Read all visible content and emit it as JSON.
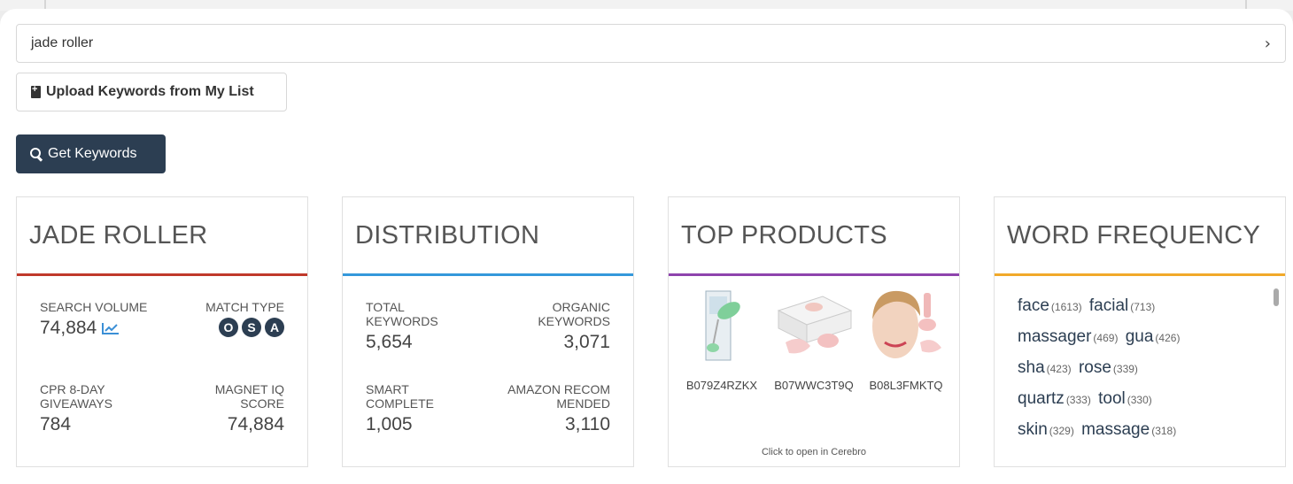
{
  "search": {
    "value": "jade roller",
    "arrow": "›"
  },
  "upload_label": "Upload Keywords from My List",
  "get_keywords_label": "Get Keywords",
  "cards": {
    "keyword": {
      "title": "JADE ROLLER",
      "search_volume_label": "SEARCH VOLUME",
      "search_volume": "74,884",
      "match_type_label": "MATCH TYPE",
      "match_badges": [
        "O",
        "S",
        "A"
      ],
      "cpr_label": "CPR 8-DAY GIVEAWAYS",
      "cpr": "784",
      "iq_label": "MAGNET IQ SCORE",
      "iq": "74,884"
    },
    "distribution": {
      "title": "DISTRIBUTION",
      "total_label": "TOTAL KEYWORDS",
      "total": "5,654",
      "organic_label": "ORGANIC KEYWORDS",
      "organic": "3,071",
      "smart_label": "SMART COMPLETE",
      "smart": "1,005",
      "amazon_label": "AMAZON RECOMMENDED",
      "amazon": "3,110"
    },
    "products": {
      "title": "TOP PRODUCTS",
      "items": [
        {
          "asin": "B079Z4RZKX"
        },
        {
          "asin": "B07WWC3T9Q"
        },
        {
          "asin": "B08L3FMKTQ"
        }
      ],
      "footer": "Click to open in Cerebro"
    },
    "words": {
      "title": "WORD FREQUENCY",
      "items": [
        {
          "word": "face",
          "count": "(1613)"
        },
        {
          "word": "facial",
          "count": "(713)"
        },
        {
          "word": "massager",
          "count": "(469)"
        },
        {
          "word": "gua",
          "count": "(426)"
        },
        {
          "word": "sha",
          "count": "(423)"
        },
        {
          "word": "rose",
          "count": "(339)"
        },
        {
          "word": "quartz",
          "count": "(333)"
        },
        {
          "word": "tool",
          "count": "(330)"
        },
        {
          "word": "skin",
          "count": "(329)"
        },
        {
          "word": "massage",
          "count": "(318)"
        }
      ]
    }
  },
  "colors": {
    "keyword_accent": "#c0392b",
    "distribution_accent": "#3498db",
    "products_accent": "#8e44ad",
    "words_accent": "#f1a92a",
    "primary": "#2c3e52"
  },
  "icons": [
    "chevron-right-icon",
    "file-upload-icon",
    "search-icon",
    "trend-chart-icon"
  ]
}
